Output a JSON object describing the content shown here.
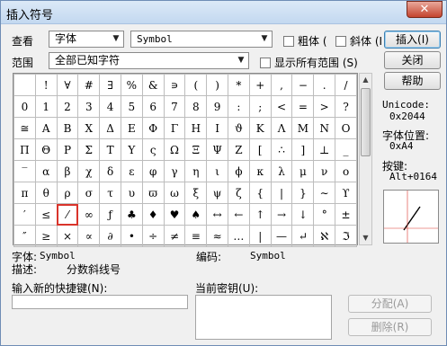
{
  "window": {
    "title": "插入符号",
    "close_glyph": "✕"
  },
  "top_row": {
    "view_label": "查看",
    "view_value": "字体",
    "font_value": "Symbol",
    "bold_label": "粗体 (",
    "italic_label": "斜体 (I"
  },
  "second_row": {
    "range_label": "范围",
    "range_value": "全部已知字符",
    "show_all_label": "显示所有范围 (S)"
  },
  "buttons": {
    "insert": "插入(I)",
    "close": "关闭",
    "help": "帮助",
    "assign": "分配(A)",
    "delete": "删除(R)"
  },
  "side_info": {
    "unicode_label": "Unicode:",
    "unicode_value": "0x2044",
    "charpos_label": "字体位置:",
    "charpos_value": "0xA4",
    "key_label": "按键:",
    "key_value": "Alt+0164"
  },
  "grid_rows": [
    [
      "",
      "!",
      "∀",
      "#",
      "∃",
      "%",
      "&",
      "∍",
      "(",
      ")",
      "*",
      "+",
      ",",
      "−",
      ".",
      "/"
    ],
    [
      "0",
      "1",
      "2",
      "3",
      "4",
      "5",
      "6",
      "7",
      "8",
      "9",
      ":",
      ";",
      "<",
      "=",
      ">",
      "?"
    ],
    [
      "≅",
      "Α",
      "Β",
      "Χ",
      "Δ",
      "Ε",
      "Φ",
      "Γ",
      "Η",
      "Ι",
      "ϑ",
      "Κ",
      "Λ",
      "Μ",
      "Ν",
      "Ο"
    ],
    [
      "Π",
      "Θ",
      "Ρ",
      "Σ",
      "Τ",
      "Υ",
      "ς",
      "Ω",
      "Ξ",
      "Ψ",
      "Ζ",
      "[",
      "∴",
      "]",
      "⊥",
      "_"
    ],
    [
      "‾",
      "α",
      "β",
      "χ",
      "δ",
      "ε",
      "φ",
      "γ",
      "η",
      "ι",
      "ϕ",
      "κ",
      "λ",
      "μ",
      "ν",
      "ο"
    ],
    [
      "π",
      "θ",
      "ρ",
      "σ",
      "τ",
      "υ",
      "ϖ",
      "ω",
      "ξ",
      "ψ",
      "ζ",
      "{",
      "|",
      "}",
      "∼",
      "ϒ"
    ],
    [
      "′",
      "≤",
      "⁄",
      "∞",
      "ƒ",
      "♣",
      "♦",
      "♥",
      "♠",
      "↔",
      "←",
      "↑",
      "→",
      "↓",
      "°",
      "±"
    ],
    [
      "″",
      "≥",
      "×",
      "∝",
      "∂",
      "•",
      "÷",
      "≠",
      "≡",
      "≈",
      "…",
      "|",
      "—",
      "↵",
      "ℵ",
      "ℑ"
    ]
  ],
  "status": {
    "font_label": "字体:",
    "font_value": "Symbol",
    "code_label": "编码:",
    "code_value": "Symbol",
    "desc_label": "描述:",
    "desc_value": "分数斜线号"
  },
  "shortcut": {
    "new_key_label": "输入新的快捷键(N):",
    "current_key_label": "当前密钥(U):"
  }
}
